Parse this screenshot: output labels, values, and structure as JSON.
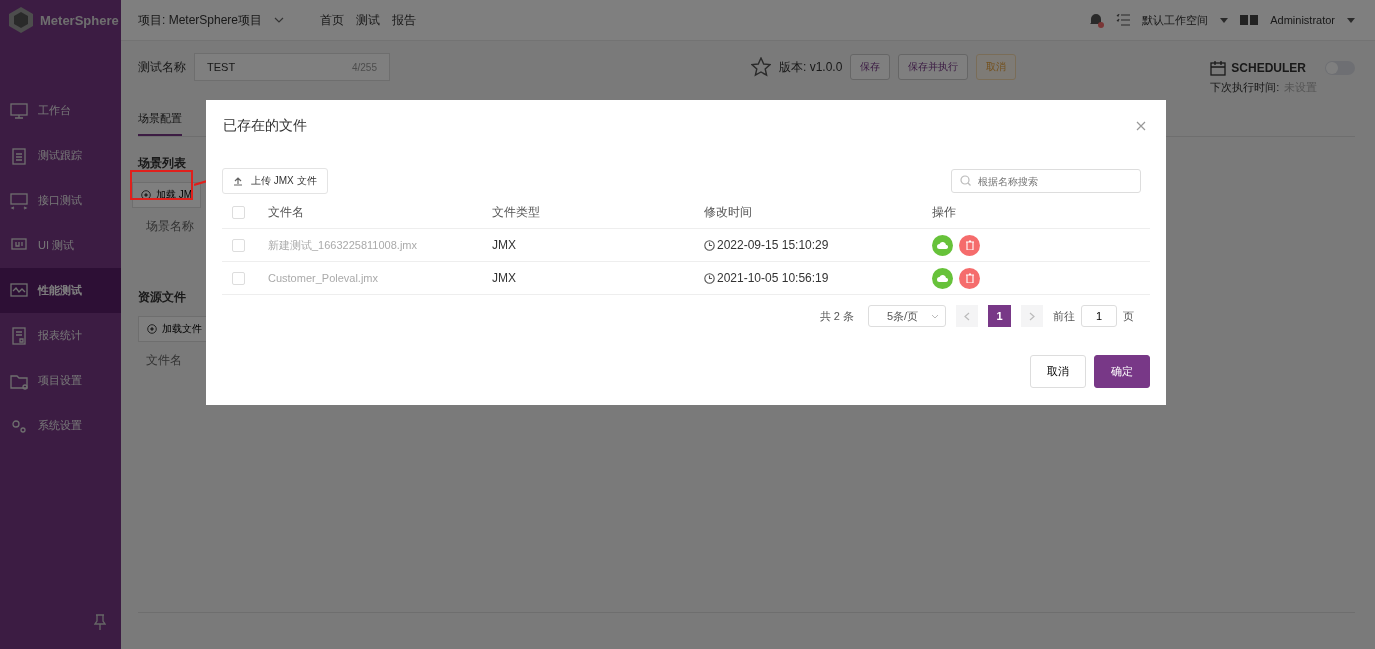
{
  "app": {
    "name": "MeterSphere"
  },
  "header": {
    "project": "项目: MeterSphere项目",
    "nav": [
      "首页",
      "测试",
      "报告"
    ],
    "workspace": "默认工作空间",
    "user": "Administrator"
  },
  "sidebar": {
    "items": [
      {
        "label": "工作台",
        "selected": false
      },
      {
        "label": "测试跟踪",
        "selected": false
      },
      {
        "label": "接口测试",
        "selected": false
      },
      {
        "label": "UI 测试",
        "selected": false
      },
      {
        "label": "性能测试",
        "selected": true
      },
      {
        "label": "报表统计",
        "selected": false
      },
      {
        "label": "项目设置",
        "selected": false
      },
      {
        "label": "系统设置",
        "selected": false
      }
    ]
  },
  "test": {
    "name_label": "测试名称",
    "name": "TEST",
    "name_count": "4/255",
    "version": "版本: v1.0.0",
    "buttons": [
      {
        "label": "保存",
        "kind": "default"
      },
      {
        "label": "保存并执行",
        "kind": "default"
      },
      {
        "label": "取消",
        "kind": "warning"
      }
    ],
    "scheduler": {
      "label": "SCHEDULER",
      "on": false,
      "next_label": "下次执行时间:",
      "next_value": "未设置"
    }
  },
  "tabs": [
    {
      "label": "场景配置",
      "selected": true
    }
  ],
  "scenes": {
    "title": "场景列表",
    "load_button": "加载 JM",
    "column": "场景名称"
  },
  "resources": {
    "title": "资源文件",
    "load_button": "加载文件",
    "column": "文件名"
  },
  "dialog": {
    "title": "已存在的文件",
    "upload_button": "上传 JMX 文件",
    "search": {
      "placeholder": "根据名称搜索"
    },
    "columns": [
      "文件名",
      "文件类型",
      "修改时间",
      "操作"
    ],
    "all_checked": false,
    "rows": [
      {
        "checked": false,
        "name": "新建测试_1663225811008.jmx",
        "type": "JMX",
        "modified": "2022-09-15 15:10:29"
      },
      {
        "checked": false,
        "name": "Customer_Poleval.jmx",
        "type": "JMX",
        "modified": "2021-10-05 10:56:19"
      }
    ],
    "pagination": {
      "total": "共 2 条",
      "page_size": "5条/页",
      "pages": [
        {
          "label": "1",
          "selected": true
        }
      ],
      "goto_label": "前往",
      "goto_value": "1",
      "goto_suffix": "页"
    },
    "footer": [
      {
        "label": "取消",
        "kind": "default"
      },
      {
        "label": "确定",
        "kind": "primary"
      }
    ]
  }
}
